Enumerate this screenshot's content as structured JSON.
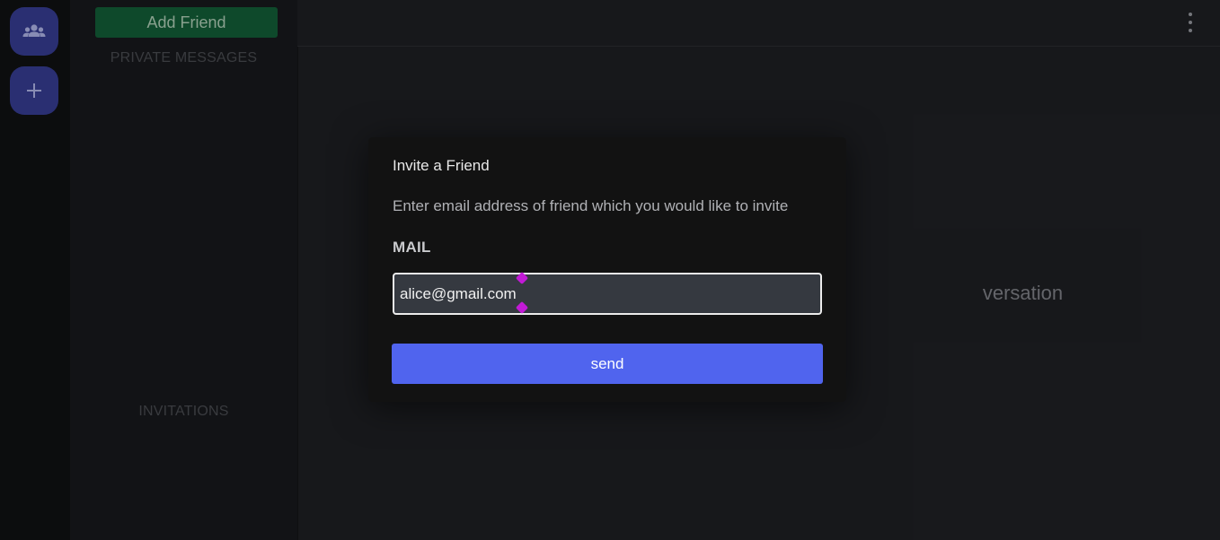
{
  "sidebar": {
    "add_friend_label": "Add Friend",
    "private_messages_label": "PRIVATE MESSAGES",
    "invitations_label": "INVITATIONS"
  },
  "server_rail": {
    "items": [
      {
        "icon": "group-icon"
      },
      {
        "icon": "plus-icon"
      }
    ]
  },
  "top_bar": {
    "menu_icon": "more-vertical-icon"
  },
  "main": {
    "empty_hint": "versation"
  },
  "dialog": {
    "title": "Invite a Friend",
    "description": "Enter email address of friend which you would like to invite",
    "field_label": "MAIL",
    "input_value": "alice@gmail.com",
    "submit_label": "send"
  },
  "colors": {
    "accent": "#5064ee",
    "add_friend_bg": "#125a35",
    "rail_button": "#343a8b",
    "text_selection_handle": "#c21ad6"
  }
}
